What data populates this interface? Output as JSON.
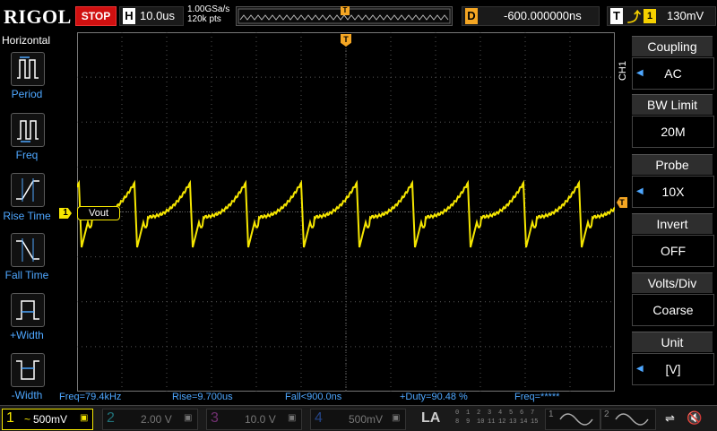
{
  "header": {
    "logo": "RIGOL",
    "run_state": "STOP",
    "horizontal_letter": "H",
    "timebase": "10.0us",
    "sample_rate": "1.00GSa/s",
    "memory_depth": "120k pts",
    "trigger_marker": "T",
    "delay_letter": "D",
    "delay": "-600.000000ns",
    "trigger_letter": "T",
    "trigger_source": "1",
    "trigger_level": "130mV"
  },
  "left_menu": {
    "title": "Horizontal",
    "items": [
      {
        "label": "Period",
        "icon": "period-icon"
      },
      {
        "label": "Freq",
        "icon": "frequency-icon"
      },
      {
        "label": "Rise Time",
        "icon": "rise-time-icon"
      },
      {
        "label": "Fall Time",
        "icon": "fall-time-icon"
      },
      {
        "label": "+Width",
        "icon": "positive-width-icon"
      },
      {
        "label": "-Width",
        "icon": "negative-width-icon"
      }
    ]
  },
  "channel_menu": {
    "channel": "CH1",
    "items": [
      {
        "title": "Coupling",
        "value": "AC"
      },
      {
        "title": "BW Limit",
        "value": "20M"
      },
      {
        "title": "Probe",
        "value": "10X"
      },
      {
        "title": "Invert",
        "value": "OFF"
      },
      {
        "title": "Volts/Div",
        "value": "Coarse"
      },
      {
        "title": "Unit",
        "value": "[V]"
      }
    ]
  },
  "trace": {
    "label": "Vout",
    "channel_marker": "1",
    "trigger_level_marker": "T",
    "color": "#f5e600"
  },
  "measurements": [
    {
      "text": "Freq=79.4kHz"
    },
    {
      "text": "Rise=9.700us"
    },
    {
      "text": "Fall<900.0ns"
    },
    {
      "text": "+Duty=90.48 %"
    },
    {
      "text": "Freq=*****"
    }
  ],
  "channels": [
    {
      "num": "1",
      "coupling": "~",
      "scale": "500mV",
      "color": "#f5e600"
    },
    {
      "num": "2",
      "scale": "2.00 V",
      "color": "#2fd3e0"
    },
    {
      "num": "3",
      "scale": "10.0 V",
      "color": "#d04fd0"
    },
    {
      "num": "4",
      "scale": "500mV",
      "color": "#3a7bff"
    }
  ],
  "logic_analyzer": {
    "label": "LA",
    "digits_top": [
      "0",
      "1",
      "2",
      "3",
      "4",
      "5",
      "6",
      "7"
    ],
    "digits_bottom": [
      "8",
      "9",
      "10",
      "11",
      "12",
      "13",
      "14",
      "15"
    ]
  },
  "generators": [
    {
      "num": "1"
    },
    {
      "num": "2"
    }
  ],
  "colors": {
    "accent_blue": "#4ea7ff",
    "trigger_orange": "#f5a623",
    "stop_red": "#d01010"
  }
}
